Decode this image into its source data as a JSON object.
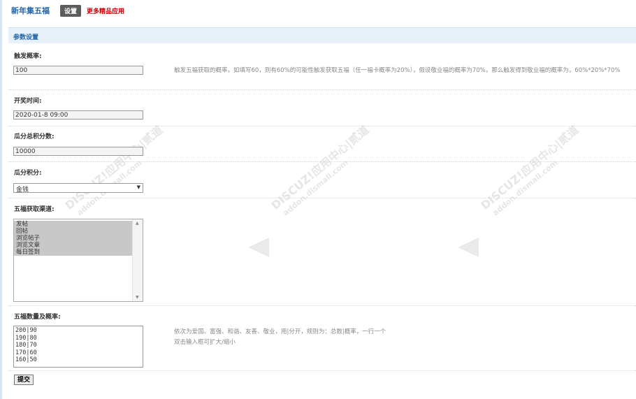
{
  "header": {
    "app_title": "新年集五福",
    "settings_tab": "设置",
    "more_link": "更多精品应用"
  },
  "section": {
    "title": "参数设置"
  },
  "fields": {
    "trigger_rate": {
      "label": "触发概率:",
      "value": "100",
      "tip": "触发五福获取的概率，如填写60，则有60%的可能性触发获取五福（任一福卡概率为20%），假设敬业福的概率为70%，那么触发得到敬业福的概率为，60%*20%*70%"
    },
    "draw_time": {
      "label": "开奖时间:",
      "value": "2020-01-8 09:00"
    },
    "total_points": {
      "label": "瓜分总积分数:",
      "value": "10000"
    },
    "points_type": {
      "label": "瓜分积分:",
      "selected": "金钱"
    },
    "channels": {
      "label": "五福获取渠道:",
      "options": [
        "发帖",
        "回帖",
        "浏览帖子",
        "浏览文章",
        "每日签到"
      ]
    },
    "fu_rates": {
      "label": "五福数量及概率:",
      "lines": [
        "200|90",
        "190|80",
        "180|70",
        "170|60",
        "160|50"
      ],
      "tip_line1": "依次为爱国、富强、和谐、友善、敬业，用|分开，规则为：总数|概率，一行一个",
      "tip_line2": "双击输入框可扩大/缩小"
    }
  },
  "submit_label": "提交",
  "watermark": {
    "text": "DISCUZ!应用中心|贰道",
    "sub": "addon.dismall.com"
  }
}
